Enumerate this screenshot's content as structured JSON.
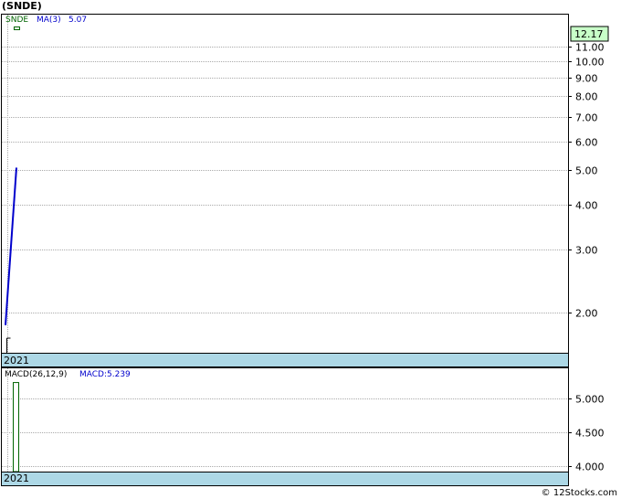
{
  "title": "(SNDE)",
  "watermark": "© 12Stocks.com",
  "colors": {
    "price": "#008000",
    "ma": "#0000cc",
    "macd": "#0000cc",
    "band": "#add8e6",
    "grid": "#aaaaaa",
    "last_price_box": "#c8ffc8"
  },
  "chart_data": [
    {
      "type": "line",
      "panel": "price",
      "scale": "log",
      "ylim": [
        1.55,
        13.5
      ],
      "legend": {
        "symbol": "SNDE",
        "ma_label": "MA(3)",
        "ma_value": "5.07"
      },
      "last_price": "12.17",
      "x": [
        "2021"
      ],
      "y_ticks": [
        {
          "value": 2,
          "label": "2.00"
        },
        {
          "value": 3,
          "label": "3.00"
        },
        {
          "value": 4,
          "label": "4.00"
        },
        {
          "value": 5,
          "label": "5.00"
        },
        {
          "value": 6,
          "label": "6.00"
        },
        {
          "value": 7,
          "label": "7.00"
        },
        {
          "value": 8,
          "label": "8.00"
        },
        {
          "value": 9,
          "label": "9.00"
        },
        {
          "value": 10,
          "label": "10.00"
        },
        {
          "value": 11,
          "label": "11.00"
        }
      ],
      "series": [
        {
          "key": "ma",
          "values": [
            1.85,
            5.07
          ]
        }
      ],
      "price_bars": [
        {
          "high": 1.6,
          "low": 1.5,
          "close": 1.6
        }
      ],
      "x_label": "2021"
    },
    {
      "type": "bar",
      "panel": "macd",
      "legend": {
        "label": "MACD(26,12,9)",
        "value_label": "MACD:5.239"
      },
      "ylim": [
        3.92,
        5.45
      ],
      "y_ticks": [
        {
          "value": 4.0,
          "label": "4.000"
        },
        {
          "value": 4.5,
          "label": "4.500"
        },
        {
          "value": 5.0,
          "label": "5.000"
        }
      ],
      "values": [
        5.239
      ],
      "x_label": "2021"
    }
  ]
}
